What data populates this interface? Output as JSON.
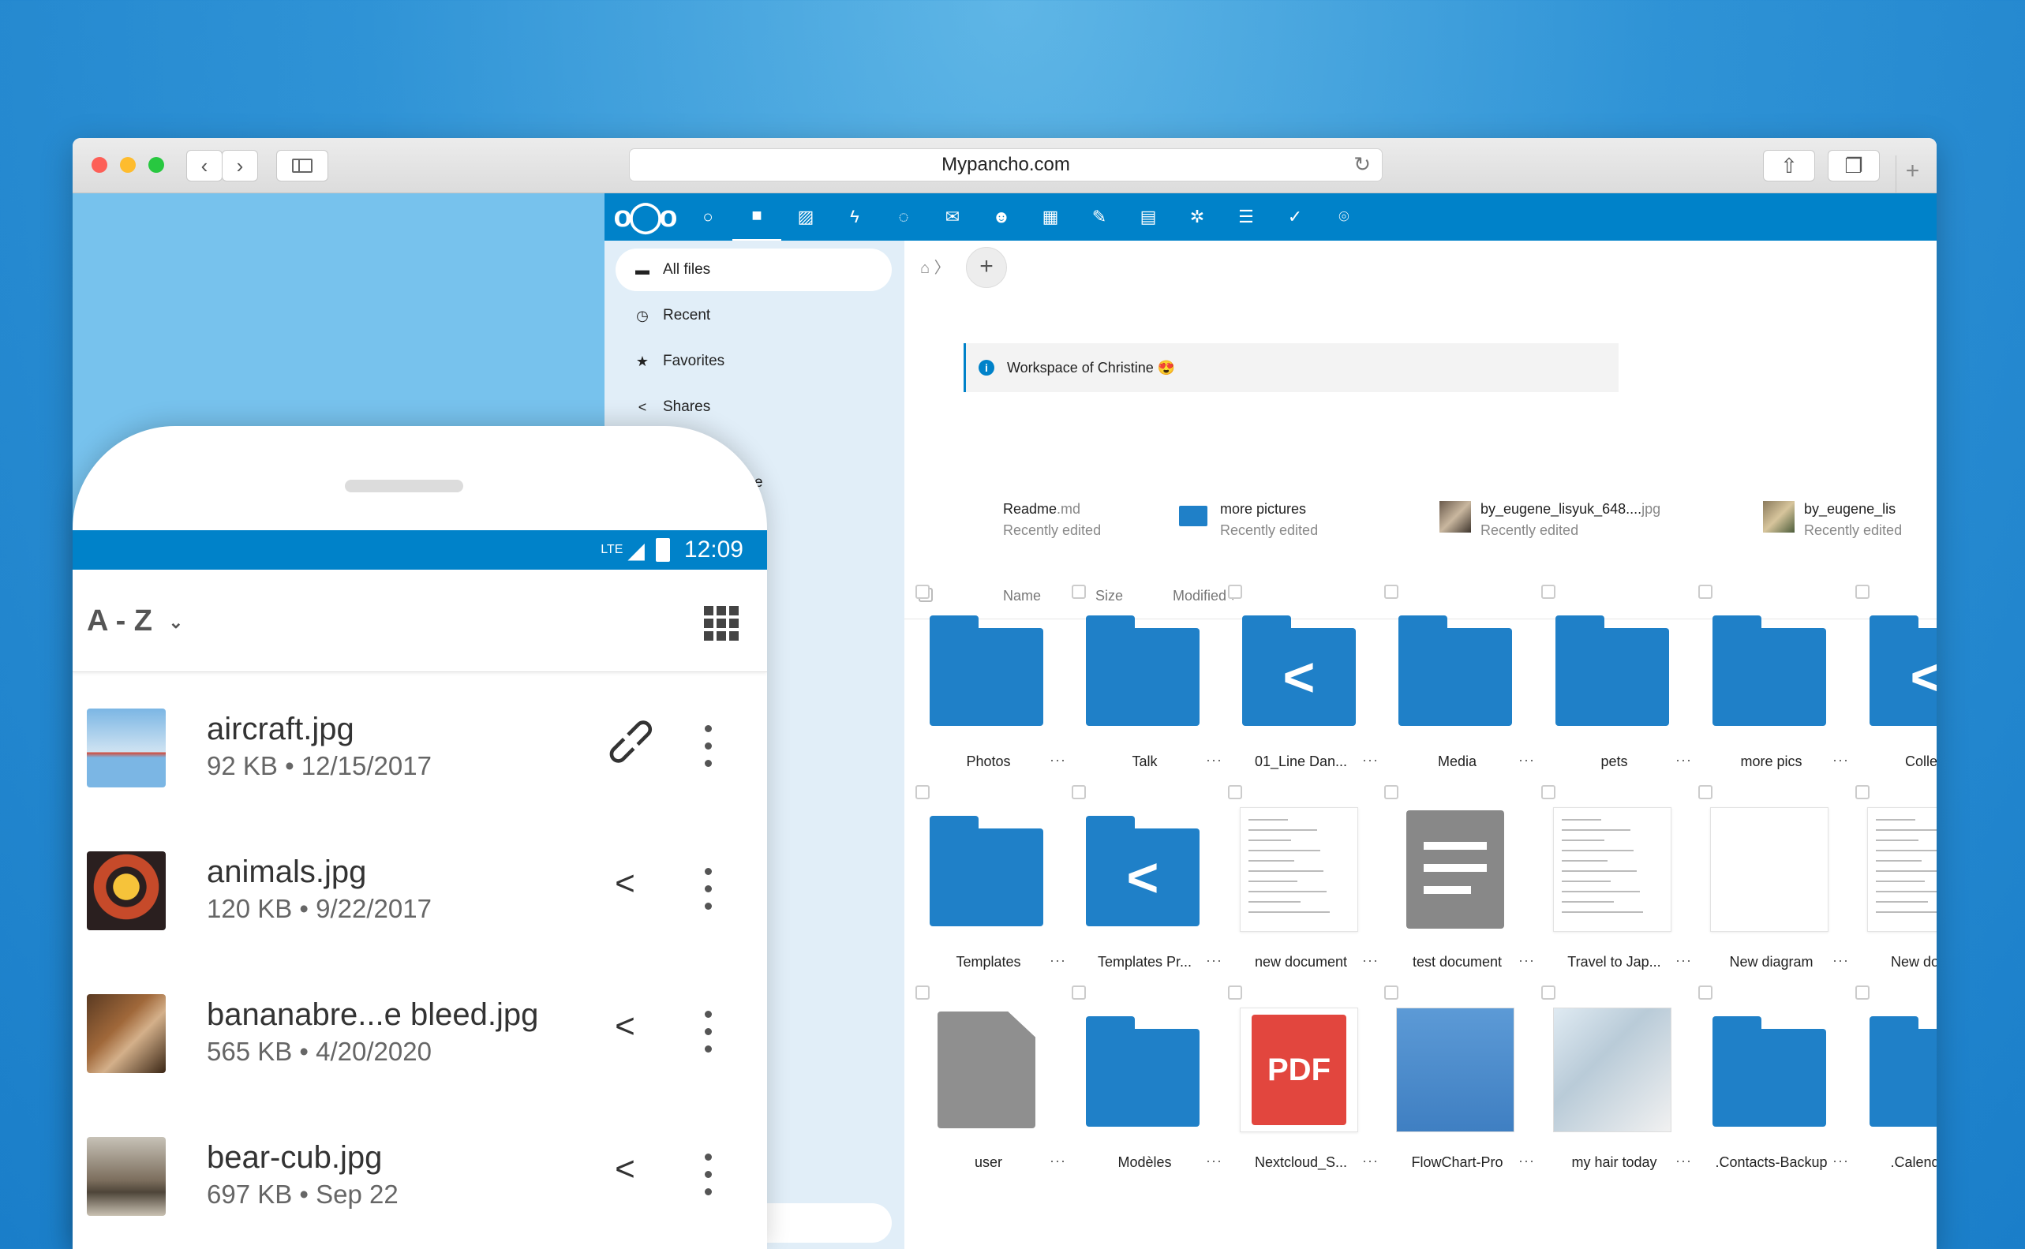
{
  "browser": {
    "url": "Mypancho.com",
    "colors": {
      "close": "#fd5f57",
      "minimize": "#febc2e",
      "zoom": "#28c840"
    }
  },
  "app": {
    "header_icons": [
      "logo",
      "circle-icon",
      "files-icon",
      "photos-icon",
      "activity-icon",
      "search-icon",
      "mail-icon",
      "contacts-icon",
      "calendar-icon",
      "notes-icon",
      "deck-icon",
      "bookmarks-icon",
      "tasks-icon",
      "check-icon",
      "maps-icon"
    ],
    "sidebar": {
      "items": [
        {
          "label": "All files",
          "icon": "folder-icon"
        },
        {
          "label": "Recent",
          "icon": "clock-icon"
        },
        {
          "label": "Favorites",
          "icon": "star-icon"
        },
        {
          "label": "Shares",
          "icon": "share-icon"
        }
      ],
      "partial": "e"
    },
    "notice": "Workspace of Christine 😍",
    "recent_label": "Recently edited",
    "recent": [
      {
        "name": "Readme",
        "ext": ".md",
        "type": "text"
      },
      {
        "name": "more pictures",
        "ext": "",
        "type": "folder"
      },
      {
        "name": "by_eugene_lisyuk_648....",
        "ext": "jpg",
        "type": "image"
      },
      {
        "name": "by_eugene_lis",
        "ext": "",
        "type": "image"
      }
    ],
    "columns": {
      "name": "Name",
      "size": "Size",
      "modified": "Modified"
    },
    "grid": [
      [
        {
          "label": "Photos",
          "type": "folder"
        },
        {
          "label": "Talk",
          "type": "folder"
        },
        {
          "label": "01_Line Dan...",
          "type": "shared-folder"
        },
        {
          "label": "Media",
          "type": "folder"
        },
        {
          "label": "pets",
          "type": "folder"
        },
        {
          "label": "more pics",
          "type": "folder"
        },
        {
          "label": "Collecti",
          "type": "shared-folder"
        }
      ],
      [
        {
          "label": "Templates",
          "type": "folder"
        },
        {
          "label": "Templates Pr...",
          "type": "shared-folder"
        },
        {
          "label": "new document",
          "type": "doc"
        },
        {
          "label": "test document",
          "type": "text-file"
        },
        {
          "label": "Travel to Jap...",
          "type": "doc"
        },
        {
          "label": "New diagram",
          "type": "blank"
        },
        {
          "label": "New docum",
          "type": "doc"
        }
      ],
      [
        {
          "label": "user",
          "type": "file"
        },
        {
          "label": "Modèles",
          "type": "folder"
        },
        {
          "label": "Nextcloud_S...",
          "type": "pdf",
          "badge": "PDF"
        },
        {
          "label": "FlowChart-Pro",
          "type": "image"
        },
        {
          "label": "my hair today",
          "type": "image"
        },
        {
          "label": ".Contacts-Backup",
          "type": "folder"
        },
        {
          "label": ".Calendar-B",
          "type": "folder"
        }
      ]
    ],
    "more": "···"
  },
  "phone": {
    "network": "LTE",
    "time": "12:09",
    "sort": "A - Z",
    "files": [
      {
        "name": "aircraft.jpg",
        "meta": "92 KB • 12/15/2017",
        "action": "link-icon"
      },
      {
        "name": "animals.jpg",
        "meta": "120 KB • 9/22/2017",
        "action": "share-icon"
      },
      {
        "name": "bananabre...e bleed.jpg",
        "meta": "565 KB • 4/20/2020",
        "action": "share-icon"
      },
      {
        "name": "bear-cub.jpg",
        "meta": "697 KB • Sep 22",
        "action": "share-icon"
      }
    ]
  }
}
